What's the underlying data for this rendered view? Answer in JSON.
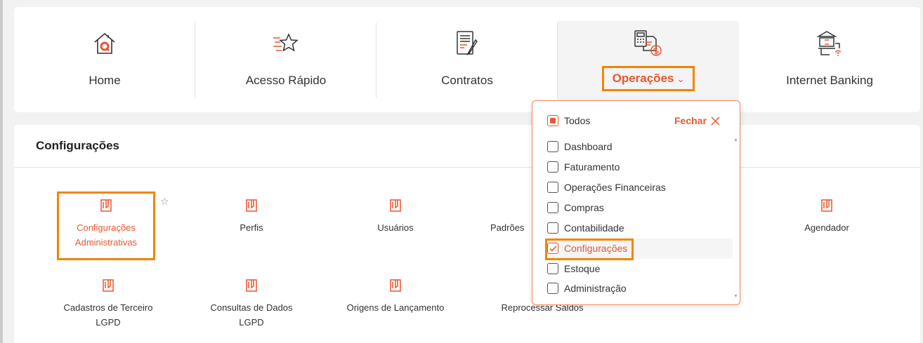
{
  "nav": {
    "items": [
      {
        "label": "Home",
        "icon": "home-icon"
      },
      {
        "label": "Acesso Rápido",
        "icon": "star-speed-icon"
      },
      {
        "label": "Contratos",
        "icon": "contract-icon"
      },
      {
        "label": "Operações",
        "icon": "operations-icon",
        "active": true
      },
      {
        "label": "Internet Banking",
        "icon": "bank-icon"
      }
    ],
    "chevron": "⌄"
  },
  "main": {
    "title": "Configurações",
    "tiles": [
      {
        "label": "Configurações Administrativas",
        "selected": true
      },
      {
        "label": "Perfis"
      },
      {
        "label": "Usuários"
      },
      {
        "label": "Padrões"
      },
      {
        "label": "Agendador"
      },
      {
        "label": "Cadastros de Terceiro LGPD"
      },
      {
        "label": "Consultas de Dados LGPD"
      },
      {
        "label": "Origens de Lançamento"
      },
      {
        "label": "Reprocessar Saldos"
      }
    ],
    "star": "☆"
  },
  "dropdown": {
    "all_label": "Todos",
    "close_label": "Fechar",
    "options": [
      {
        "label": "Dashboard",
        "checked": false
      },
      {
        "label": "Faturamento",
        "checked": false
      },
      {
        "label": "Operações Financeiras",
        "checked": false
      },
      {
        "label": "Compras",
        "checked": false
      },
      {
        "label": "Contabilidade",
        "checked": false
      },
      {
        "label": "Configurações",
        "checked": true
      },
      {
        "label": "Estoque",
        "checked": false
      },
      {
        "label": "Administração",
        "checked": false
      }
    ]
  },
  "colors": {
    "accent": "#e8572f",
    "highlight_border": "#f28500"
  }
}
